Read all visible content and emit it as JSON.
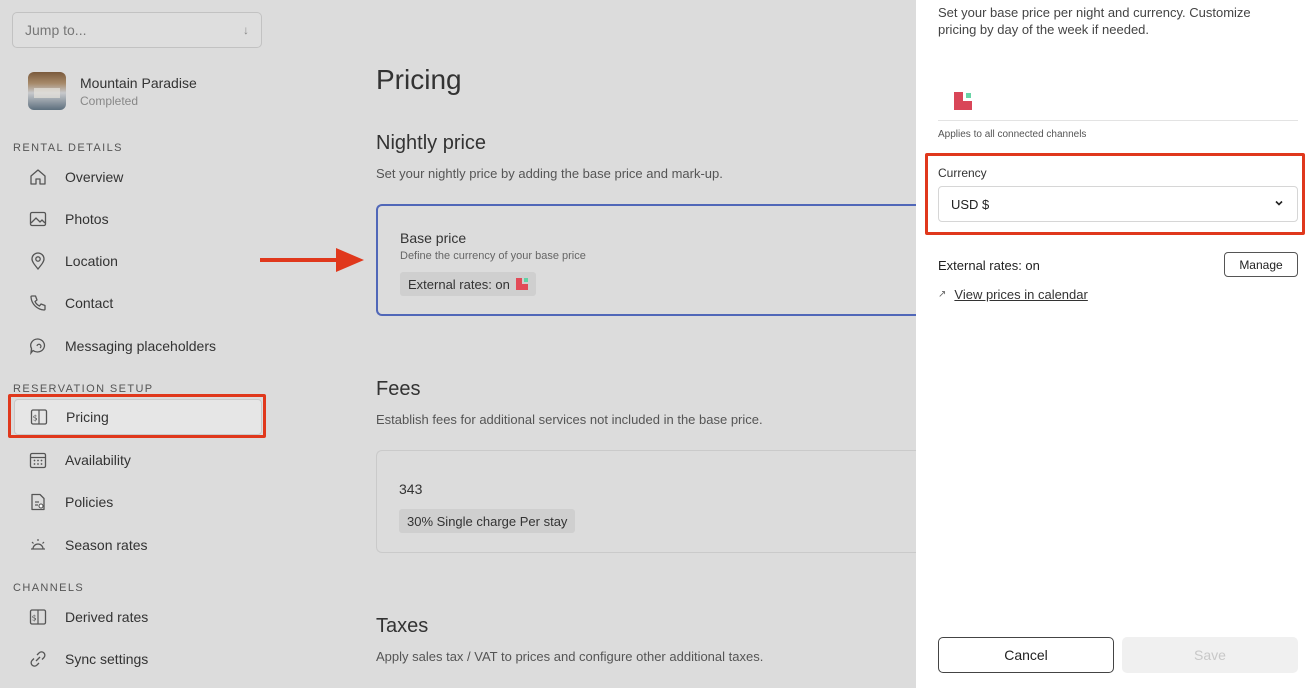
{
  "sidebar": {
    "jump_placeholder": "Jump to...",
    "property": {
      "name": "Mountain Paradise",
      "status": "Completed"
    },
    "sections": {
      "rental_details": "RENTAL DETAILS",
      "reservation_setup": "RESERVATION SETUP",
      "channels": "CHANNELS"
    },
    "items": [
      {
        "label": "Overview",
        "icon": "house-icon"
      },
      {
        "label": "Photos",
        "icon": "image-icon"
      },
      {
        "label": "Location",
        "icon": "location-pin-icon"
      },
      {
        "label": "Contact",
        "icon": "phone-icon"
      },
      {
        "label": "Messaging placeholders",
        "icon": "chat-bubble-icon"
      },
      {
        "label": "Pricing",
        "icon": "dollar-tag-icon",
        "active": true
      },
      {
        "label": "Availability",
        "icon": "calendar-icon"
      },
      {
        "label": "Policies",
        "icon": "document-icon"
      },
      {
        "label": "Season rates",
        "icon": "sun-icon"
      },
      {
        "label": "Derived rates",
        "icon": "dollar-tag-icon"
      },
      {
        "label": "Sync settings",
        "icon": "link-icon"
      }
    ]
  },
  "main": {
    "title": "Pricing",
    "nightly": {
      "heading": "Nightly price",
      "desc": "Set your nightly price by adding the base price and mark-up.",
      "card_title": "Base price",
      "card_sub": "Define the currency of your base price",
      "chip": "External rates: on"
    },
    "fees": {
      "heading": "Fees",
      "desc": "Establish fees for additional services not included in the base price.",
      "amount": "343",
      "chip": "30% Single charge Per stay"
    },
    "taxes": {
      "heading": "Taxes",
      "desc": "Apply sales tax / VAT to prices and configure other additional taxes."
    }
  },
  "panel": {
    "intro": "Set your base price per night and currency. Customize pricing by day of the week if needed.",
    "applies": "Applies to all connected channels",
    "currency_label": "Currency",
    "currency_value": "USD $",
    "external_rates": "External rates: on",
    "manage": "Manage",
    "view_link": "View prices in calendar",
    "cancel": "Cancel",
    "save": "Save"
  },
  "colors": {
    "highlight": "#e0381c",
    "card_border": "#5067b8",
    "brand_red": "#d94658",
    "brand_green": "#69d4a6"
  }
}
